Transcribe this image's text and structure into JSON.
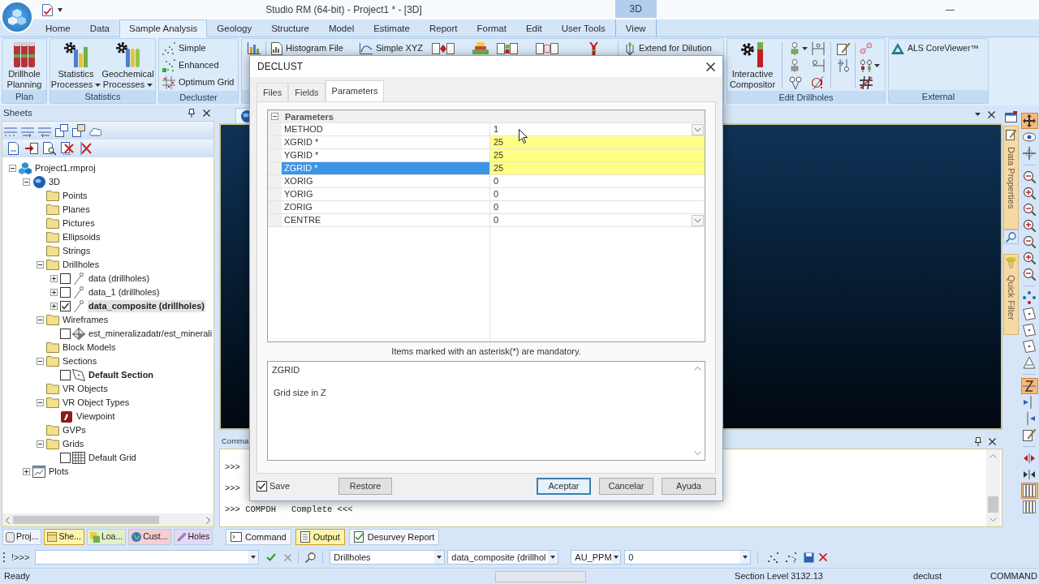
{
  "title_bar": {
    "title": "Studio RM (64-bit) - Project1 * - [3D]"
  },
  "ribbon": {
    "tabs": [
      {
        "label": "Home",
        "selected": false
      },
      {
        "label": "Data",
        "selected": false
      },
      {
        "label": "Sample Analysis",
        "selected": true
      },
      {
        "label": "Geology",
        "selected": false
      },
      {
        "label": "Structure",
        "selected": false
      },
      {
        "label": "Model",
        "selected": false
      },
      {
        "label": "Estimate",
        "selected": false
      },
      {
        "label": "Report",
        "selected": false
      },
      {
        "label": "Format",
        "selected": false
      },
      {
        "label": "Edit",
        "selected": false
      },
      {
        "label": "User Tools",
        "selected": false
      },
      {
        "label": "View",
        "selected": false,
        "context": "3D"
      }
    ],
    "groups": [
      {
        "label": "Plan",
        "items": [
          {
            "kind": "large",
            "label": "Drillhole Planning",
            "dropdown": false
          }
        ]
      },
      {
        "label": "Statistics",
        "items": [
          {
            "kind": "large",
            "label": "Statistics Processes",
            "dropdown": true
          },
          {
            "kind": "large",
            "label": "Geochemical Processes",
            "dropdown": true
          }
        ]
      },
      {
        "label": "Decluster",
        "items": [
          {
            "kind": "small",
            "label": "Simple"
          },
          {
            "kind": "small",
            "label": "Enhanced"
          },
          {
            "kind": "small",
            "label": "Optimum Grid"
          }
        ]
      },
      {
        "items": [
          {
            "kind": "small",
            "label": "Histogram File"
          },
          {
            "kind": "small",
            "label": "Simple XYZ"
          },
          {
            "kind": "small",
            "label": "Extend for Dilution"
          }
        ]
      },
      {
        "label": "Edit Drillholes",
        "items": [
          {
            "kind": "large",
            "label": "Interactive Compositor",
            "dropdown": false
          }
        ]
      },
      {
        "label": "External",
        "items": [
          {
            "kind": "small",
            "label": "ALS CoreViewer™"
          }
        ]
      }
    ]
  },
  "sheets": {
    "title": "Sheets",
    "tree": [
      {
        "label": "Project1.rmproj",
        "kind": "project",
        "expanded": true,
        "selected": false,
        "children": [
          {
            "label": "3D",
            "kind": "view",
            "expanded": true,
            "selected": false,
            "children": [
              {
                "label": "Points",
                "kind": "folder",
                "selected": false
              },
              {
                "label": "Planes",
                "kind": "folder",
                "selected": false
              },
              {
                "label": "Pictures",
                "kind": "folder",
                "selected": false
              },
              {
                "label": "Ellipsoids",
                "kind": "folder",
                "selected": false
              },
              {
                "label": "Strings",
                "kind": "folder",
                "selected": false
              },
              {
                "label": "Drillholes",
                "kind": "folder",
                "expanded": true,
                "selected": false,
                "children": [
                  {
                    "label": "data (drillholes)",
                    "kind": "drillholes",
                    "expanded": false,
                    "checked": false,
                    "active": false,
                    "selected": false
                  },
                  {
                    "label": "data_1 (drillholes)",
                    "kind": "drillholes",
                    "expanded": false,
                    "checked": false,
                    "active": false,
                    "selected": false
                  },
                  {
                    "label": "data_composite (drillholes)",
                    "kind": "drillholes",
                    "expanded": false,
                    "checked": true,
                    "active": true,
                    "selected": true
                  }
                ]
              },
              {
                "label": "Wireframes",
                "kind": "folder",
                "expanded": true,
                "selected": false,
                "children": [
                  {
                    "label": "est_mineralizadatr/est_minerali",
                    "kind": "wireframe",
                    "checked": false,
                    "active": false,
                    "selected": false
                  }
                ]
              },
              {
                "label": "Block Models",
                "kind": "folder",
                "selected": false
              },
              {
                "label": "Sections",
                "kind": "folder",
                "expanded": true,
                "selected": false,
                "children": [
                  {
                    "label": "Default Section",
                    "kind": "section",
                    "checked": false,
                    "active": true,
                    "selected": false
                  }
                ]
              },
              {
                "label": "VR Objects",
                "kind": "folder",
                "selected": false
              },
              {
                "label": "VR Object Types",
                "kind": "folder",
                "expanded": true,
                "selected": false,
                "children": [
                  {
                    "label": "Viewpoint",
                    "kind": "viewpoint",
                    "selected": false
                  }
                ]
              },
              {
                "label": "GVPs",
                "kind": "folder",
                "selected": false
              },
              {
                "label": "Grids",
                "kind": "folder",
                "expanded": true,
                "selected": false,
                "children": [
                  {
                    "label": "Default Grid",
                    "kind": "grid",
                    "checked": false,
                    "active": false,
                    "selected": false
                  }
                ]
              }
            ]
          },
          {
            "label": "Plots",
            "kind": "plots",
            "expanded": false,
            "selected": false
          }
        ]
      }
    ]
  },
  "command_panel": {
    "title": "Comma",
    "lines": [
      ">>>",
      ">>>",
      ">>> COMPDH   Complete <<<"
    ]
  },
  "side_tabs": [
    {
      "label": "Data Properties"
    },
    {
      "label": "Quick Filter"
    }
  ],
  "view_toolbar": {
    "groups": [
      {
        "buttons": [
          {
            "on": true
          },
          {
            "on": false
          },
          {
            "on": false
          }
        ]
      },
      {
        "buttons": [
          {
            "on": false
          },
          {
            "on": false
          },
          {
            "on": false
          },
          {
            "on": false
          },
          {
            "on": false
          },
          {
            "on": false
          },
          {
            "on": false
          }
        ]
      },
      {
        "buttons": [
          {
            "on": false
          },
          {
            "on": false
          },
          {
            "on": false
          },
          {
            "on": false
          },
          {
            "on": false
          }
        ]
      },
      {
        "buttons": [
          {
            "on": true
          },
          {
            "on": false
          },
          {
            "on": false
          },
          {
            "on": false
          }
        ]
      },
      {
        "buttons": [
          {
            "on": false
          },
          {
            "on": false
          },
          {
            "on": true
          },
          {
            "on": false
          }
        ]
      }
    ]
  },
  "bottom_tabs_left": [
    {
      "label": "Proj...",
      "selected": false,
      "color": "#eef3fa"
    },
    {
      "label": "She...",
      "selected": true,
      "color": "#fff4a8"
    },
    {
      "label": "Loa...",
      "selected": false,
      "color": "#e2f0c8"
    },
    {
      "label": "Cust...",
      "selected": false,
      "color": "#f6cdd3"
    },
    {
      "label": "Holes",
      "selected": false,
      "color": "#e4d8f4"
    }
  ],
  "bottom_tabs_right": [
    {
      "label": "Command",
      "selected": false
    },
    {
      "label": "Output",
      "selected": true
    },
    {
      "label": "Desurvey Report",
      "selected": false
    }
  ],
  "command_bar": {
    "prompt": "!>>>",
    "dropdowns": [
      "Drillholes",
      "data_composite (drillhol",
      "AU_PPM",
      "0"
    ]
  },
  "status_bar": [
    "Ready",
    "Section Level 3132.13",
    "declust",
    "COMMAND"
  ],
  "dialog": {
    "title": "DECLUST",
    "tabs": [
      {
        "label": "Files",
        "selected": false
      },
      {
        "label": "Fields",
        "selected": false
      },
      {
        "label": "Parameters",
        "selected": true
      }
    ],
    "grid": {
      "category": "Parameters",
      "expanded": true,
      "rows": [
        {
          "name": "METHOD",
          "value": "1",
          "kind": "dropdown",
          "mandatory": false,
          "selected": false
        },
        {
          "name": "XGRID *",
          "value": "25",
          "kind": "text",
          "mandatory": true,
          "selected": false
        },
        {
          "name": "YGRID *",
          "value": "25",
          "kind": "text",
          "mandatory": true,
          "selected": false
        },
        {
          "name": "ZGRID *",
          "value": "25",
          "kind": "text",
          "mandatory": true,
          "selected": true
        },
        {
          "name": "XORIG",
          "value": "0",
          "kind": "text",
          "mandatory": false,
          "selected": false
        },
        {
          "name": "YORIG",
          "value": "0",
          "kind": "text",
          "mandatory": false,
          "selected": false
        },
        {
          "name": "ZORIG",
          "value": "0",
          "kind": "text",
          "mandatory": false,
          "selected": false
        },
        {
          "name": "CENTRE",
          "value": "0",
          "kind": "dropdown",
          "mandatory": false,
          "selected": false
        }
      ]
    },
    "note": "Items marked with an asterisk(*) are mandatory.",
    "description": {
      "title": "ZGRID",
      "text": "Grid size in Z"
    },
    "save": {
      "label": "Save",
      "checked": true
    },
    "restore": "Restore",
    "buttons": [
      {
        "label": "Aceptar",
        "default": true
      },
      {
        "label": "Cancelar",
        "default": false
      },
      {
        "label": "Ayuda",
        "default": false
      }
    ]
  }
}
